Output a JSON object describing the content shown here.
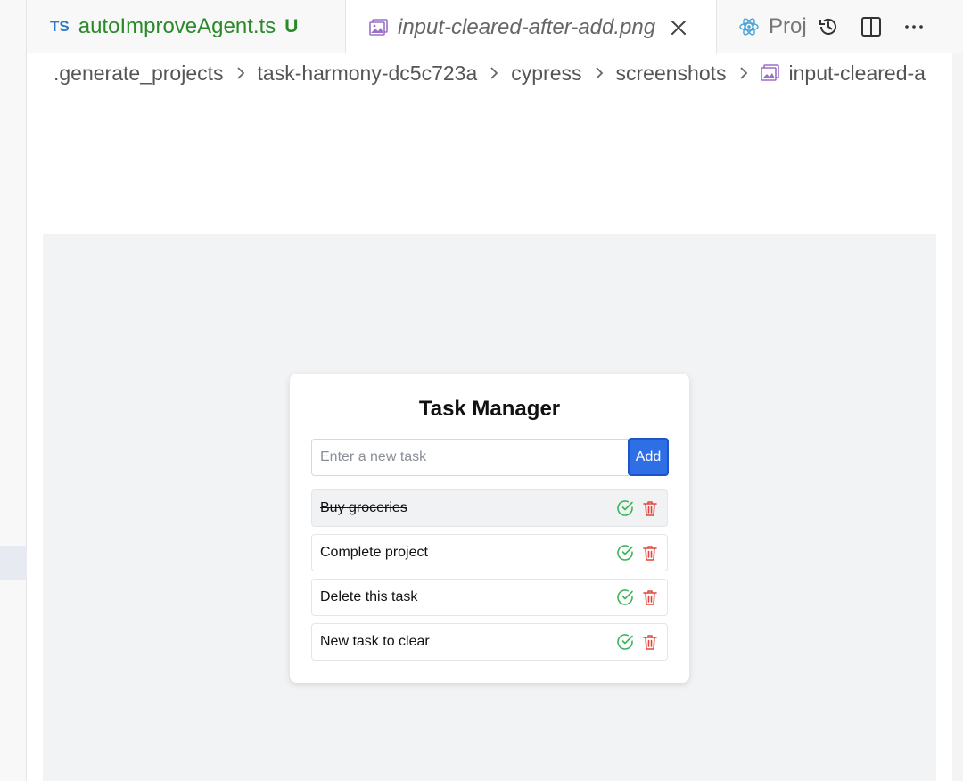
{
  "tabs": [
    {
      "badge": "TS",
      "label": "autoImproveAgent.ts",
      "status": "U",
      "icon": "typescript-icon"
    },
    {
      "label": "input-cleared-after-add.png",
      "icon": "image-icon",
      "active": true
    },
    {
      "label": "Proj",
      "icon": "react-icon"
    }
  ],
  "breadcrumb": [
    ".generate_projects",
    "task-harmony-dc5c723a",
    "cypress",
    "screenshots",
    "input-cleared-a"
  ],
  "app": {
    "title": "Task Manager",
    "input_placeholder": "Enter a new task",
    "input_value": "",
    "add_label": "Add",
    "tasks": [
      {
        "text": "Buy groceries",
        "completed": true
      },
      {
        "text": "Complete project",
        "completed": false
      },
      {
        "text": "Delete this task",
        "completed": false
      },
      {
        "text": "New task to clear",
        "completed": false
      }
    ]
  },
  "colors": {
    "accent": "#2f6fe6",
    "complete_icon": "#3cb55a",
    "delete_icon": "#e0463c",
    "modified": "#2a8a2a",
    "ts_badge": "#3178c6"
  }
}
